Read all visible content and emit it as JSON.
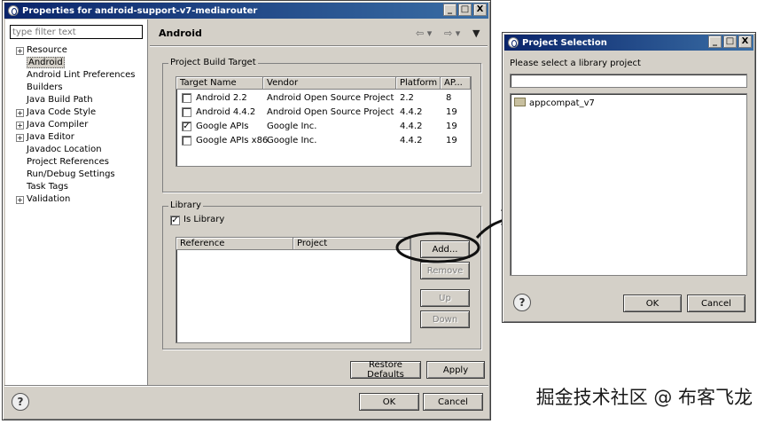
{
  "properties_window": {
    "title": "Properties for android-support-v7-mediarouter",
    "filter_placeholder": "type filter text",
    "tree": [
      {
        "label": "Resource",
        "expandable": true
      },
      {
        "label": "Android",
        "expandable": false,
        "selected": true
      },
      {
        "label": "Android Lint Preferences",
        "expandable": false
      },
      {
        "label": "Builders",
        "expandable": false
      },
      {
        "label": "Java Build Path",
        "expandable": false
      },
      {
        "label": "Java Code Style",
        "expandable": true
      },
      {
        "label": "Java Compiler",
        "expandable": true
      },
      {
        "label": "Java Editor",
        "expandable": true
      },
      {
        "label": "Javadoc Location",
        "expandable": false
      },
      {
        "label": "Project References",
        "expandable": false
      },
      {
        "label": "Run/Debug Settings",
        "expandable": false
      },
      {
        "label": "Task Tags",
        "expandable": false
      },
      {
        "label": "Validation",
        "expandable": true
      }
    ],
    "page_title": "Android",
    "build_target": {
      "group_label": "Project Build Target",
      "columns": [
        "Target Name",
        "Vendor",
        "Platform",
        "AP..."
      ],
      "rows": [
        {
          "checked": false,
          "name": "Android 2.2",
          "vendor": "Android Open Source Project",
          "platform": "2.2",
          "api": "8"
        },
        {
          "checked": false,
          "name": "Android 4.4.2",
          "vendor": "Android Open Source Project",
          "platform": "4.4.2",
          "api": "19"
        },
        {
          "checked": true,
          "name": "Google APIs",
          "vendor": "Google Inc.",
          "platform": "4.4.2",
          "api": "19"
        },
        {
          "checked": false,
          "name": "Google APIs x86",
          "vendor": "Google Inc.",
          "platform": "4.4.2",
          "api": "19"
        }
      ]
    },
    "library": {
      "group_label": "Library",
      "is_library_label": "Is Library",
      "is_library_checked": true,
      "columns": [
        "Reference",
        "Project"
      ],
      "add_label": "Add...",
      "remove_label": "Remove",
      "up_label": "Up",
      "down_label": "Down"
    },
    "restore_defaults_label": "Restore Defaults",
    "apply_label": "Apply",
    "ok_label": "OK",
    "cancel_label": "Cancel"
  },
  "project_selection_window": {
    "title": "Project Selection",
    "prompt": "Please select a library project",
    "filter_value": "",
    "projects": [
      "appcompat_v7"
    ],
    "ok_label": "OK",
    "cancel_label": "Cancel"
  },
  "titlebar_buttons": [
    "_",
    "□",
    "X"
  ],
  "help_symbol": "?",
  "watermark": "掘金技术社区 @ 布客飞龙",
  "colors": {
    "titlebar_start": "#0a246a",
    "titlebar_end": "#3a6ea5",
    "window_bg": "#d4d0c8"
  }
}
